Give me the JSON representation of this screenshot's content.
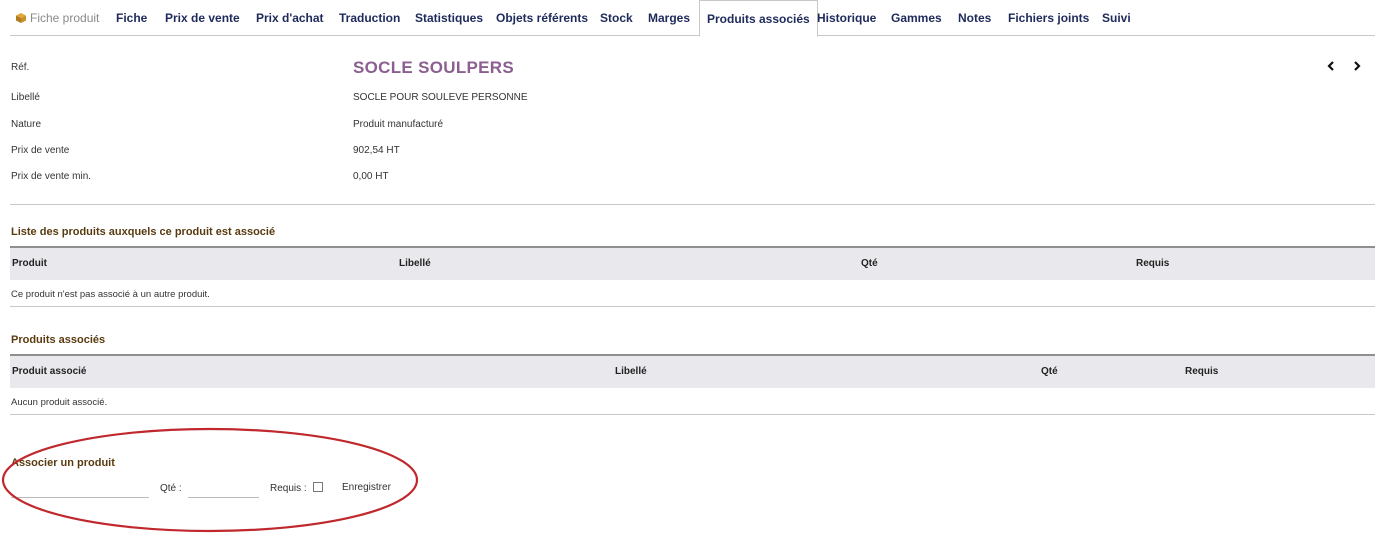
{
  "tabs": [
    {
      "label": "Fiche produit",
      "muted": true,
      "icon": "product-cube-icon"
    },
    {
      "label": "Fiche"
    },
    {
      "label": "Prix de vente"
    },
    {
      "label": "Prix d'achat"
    },
    {
      "label": "Traduction"
    },
    {
      "label": "Statistiques"
    },
    {
      "label": "Objets référents"
    },
    {
      "label": "Stock"
    },
    {
      "label": "Marges"
    },
    {
      "label": "Produits associés",
      "active": true
    },
    {
      "label": "Historique"
    },
    {
      "label": "Gammes"
    },
    {
      "label": "Notes"
    },
    {
      "label": "Fichiers joints"
    },
    {
      "label": "Suivi"
    }
  ],
  "product": {
    "ref_label": "Réf.",
    "ref_value": "SOCLE SOULPERS",
    "libelle_label": "Libellé",
    "libelle_value": "SOCLE POUR SOULEVE PERSONNE",
    "nature_label": "Nature",
    "nature_value": "Produit manufacturé",
    "price_label": "Prix de vente",
    "price_value": "902,54 HT",
    "min_price_label": "Prix de vente min.",
    "min_price_value": "0,00 HT",
    "prev_icon": "chevron-left-icon",
    "next_icon": "chevron-right-icon"
  },
  "parent_section": {
    "title": "Liste des produits auxquels ce produit est associé",
    "columns": [
      "Produit",
      "Libellé",
      "Qté",
      "Requis"
    ],
    "empty_text": "Ce produit n'est pas associé à un autre produit."
  },
  "associated_section": {
    "title": "Produits associés",
    "columns": [
      "Produit associé",
      "Libellé",
      "Qté",
      "Requis"
    ],
    "empty_text": "Aucun produit associé."
  },
  "associate_form": {
    "title": "Associer un produit",
    "product_value": "",
    "qty_label": "Qté :",
    "qty_value": "",
    "required_label": "Requis :",
    "required_checked": false,
    "save_label": "Enregistrer"
  },
  "colors": {
    "tab_text": "#1e2a5a",
    "ref_value": "#8b5f8f",
    "section_title": "#5a3b10",
    "table_header_bg": "#e9e9ed",
    "annotation": "#c0282d"
  }
}
